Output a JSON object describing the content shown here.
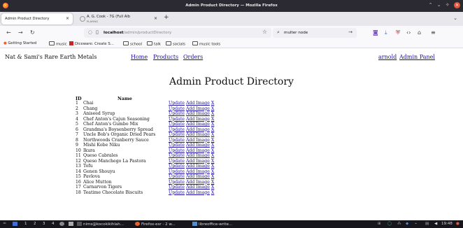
{
  "window": {
    "title": "Admin Product Directory — Mozilla Firefox"
  },
  "tabs": [
    {
      "title": "Admin Product Directory"
    },
    {
      "title": "A. G. Cook - 7G (Full Alb",
      "subtitle": "PLAYING"
    }
  ],
  "nav": {
    "url_host": "localhost",
    "url_path": "/admin/productDirectory",
    "search_value": "multer node"
  },
  "bookmarks": [
    "Getting Started",
    "music",
    "Diceware: Create S...",
    "school",
    "talk",
    "socials",
    "music tools"
  ],
  "site": {
    "brand": "Nat & Sami's Rare Earth Metals",
    "links": [
      "Home",
      "Products",
      "Orders"
    ],
    "user": "arnold",
    "admin": "Admin Panel"
  },
  "page": {
    "heading": "Admin Product Directory",
    "col_id": "ID",
    "col_name": "Name",
    "action_update": "Update",
    "action_add_image": "Add Image",
    "action_delete": "X"
  },
  "products": [
    {
      "id": "1",
      "name": "Chai"
    },
    {
      "id": "2",
      "name": "Chang"
    },
    {
      "id": "3",
      "name": "Aniseed Syrup"
    },
    {
      "id": "4",
      "name": "Chef Anton's Cajun Seasoning"
    },
    {
      "id": "5",
      "name": "Chef Anton's Gumbo Mix"
    },
    {
      "id": "6",
      "name": "Grandma's Boysenberry Spread"
    },
    {
      "id": "7",
      "name": "Uncle Bob's Organic Dried Pears"
    },
    {
      "id": "8",
      "name": "Northwoods Cranberry Sauce"
    },
    {
      "id": "9",
      "name": "Mishi Kobe Niku"
    },
    {
      "id": "10",
      "name": "Ikura"
    },
    {
      "id": "11",
      "name": "Queso Cabrales"
    },
    {
      "id": "12",
      "name": "Queso Manchego La Pastora"
    },
    {
      "id": "13",
      "name": "Tofu"
    },
    {
      "id": "14",
      "name": "Genen Shouyu"
    },
    {
      "id": "15",
      "name": "Pavlova"
    },
    {
      "id": "16",
      "name": "Alice Mutton"
    },
    {
      "id": "17",
      "name": "Carnarvon Tigers"
    },
    {
      "id": "18",
      "name": "Teatime Chocolate Biscuits"
    }
  ],
  "taskbar": {
    "workspaces": [
      "1",
      "2",
      "3",
      "4"
    ],
    "items": [
      "nims@kocokikihlah...",
      "Firefox-esr - 2 w...",
      "libreoffice-write..."
    ],
    "clock": "19:48"
  }
}
